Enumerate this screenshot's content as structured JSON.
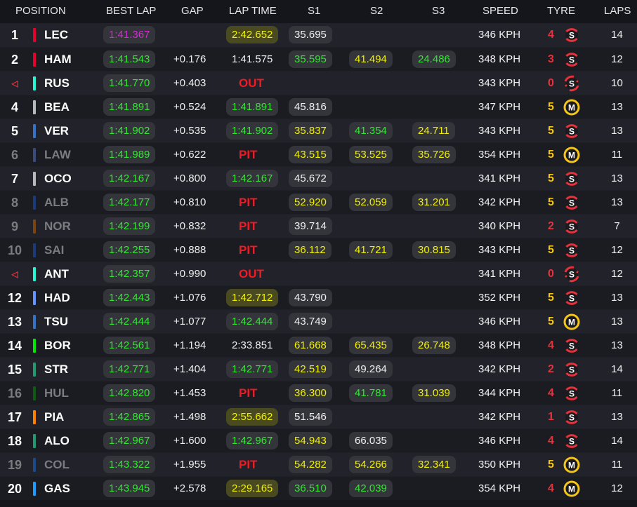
{
  "headers": {
    "position": "POSITION",
    "best_lap": "BEST LAP",
    "gap": "GAP",
    "lap_time": "LAP TIME",
    "s1": "S1",
    "s2": "S2",
    "s3": "S3",
    "speed": "SPEED",
    "tyre": "TYRE",
    "laps": "LAPS"
  },
  "colors": {
    "green": "#32e632",
    "yellow": "#f0f000",
    "purple": "#d42ad4",
    "red": "#ee1c25",
    "orange_age": "#ff8a1e",
    "red_age": "#e8313a",
    "soft": "#e8313a",
    "medium": "#f5c518"
  },
  "rows": [
    {
      "pos": "1",
      "code": "LEC",
      "team": "#e8002d",
      "dim": false,
      "best": "1:41.367",
      "best_color": "purple",
      "gap": "",
      "lap": "2:42.652",
      "lap_color": "yellow",
      "status": "",
      "s1": "35.695",
      "s1c": "white",
      "s2": "",
      "s2c": "",
      "s3": "",
      "s3c": "",
      "speed": "346 KPH",
      "age": "4",
      "tyre": "S",
      "tyre_icon": "soft-tyre-icon",
      "laps": "14"
    },
    {
      "pos": "2",
      "code": "HAM",
      "team": "#e8002d",
      "dim": false,
      "best": "1:41.543",
      "best_color": "green",
      "gap": "+0.176",
      "lap": "1:41.575",
      "lap_color": "plain",
      "status": "",
      "s1": "35.595",
      "s1c": "green",
      "s2": "41.494",
      "s2c": "yellow",
      "s3": "24.486",
      "s3c": "green",
      "speed": "348 KPH",
      "age": "3",
      "tyre": "S",
      "tyre_icon": "soft-tyre-icon",
      "laps": "12"
    },
    {
      "pos": "◁",
      "code": "RUS",
      "team": "#27f4d2",
      "dim": false,
      "best": "1:41.770",
      "best_color": "green",
      "gap": "+0.403",
      "lap": "",
      "lap_color": "",
      "status": "OUT",
      "s1": "",
      "s1c": "",
      "s2": "",
      "s2c": "",
      "s3": "",
      "s3c": "",
      "speed": "343 KPH",
      "age": "0",
      "tyre": "S",
      "tyre_icon": "soft-tyre-icon",
      "laps": "10"
    },
    {
      "pos": "4",
      "code": "BEA",
      "team": "#b6babd",
      "dim": false,
      "best": "1:41.891",
      "best_color": "green",
      "gap": "+0.524",
      "lap": "1:41.891",
      "lap_color": "green",
      "status": "",
      "s1": "45.816",
      "s1c": "white",
      "s2": "",
      "s2c": "",
      "s3": "",
      "s3c": "",
      "speed": "347 KPH",
      "age": "5",
      "tyre": "M",
      "tyre_icon": "medium-tyre-icon",
      "laps": "13"
    },
    {
      "pos": "5",
      "code": "VER",
      "team": "#3671c6",
      "dim": false,
      "best": "1:41.902",
      "best_color": "green",
      "gap": "+0.535",
      "lap": "1:41.902",
      "lap_color": "green",
      "status": "",
      "s1": "35.837",
      "s1c": "yellow",
      "s2": "41.354",
      "s2c": "green",
      "s3": "24.711",
      "s3c": "yellow",
      "speed": "343 KPH",
      "age": "5",
      "tyre": "S",
      "tyre_icon": "soft-tyre-icon",
      "laps": "13"
    },
    {
      "pos": "6",
      "code": "LAW",
      "team": "#3a4a7a",
      "dim": true,
      "best": "1:41.989",
      "best_color": "green",
      "gap": "+0.622",
      "lap": "",
      "lap_color": "",
      "status": "PIT",
      "s1": "43.515",
      "s1c": "yellow",
      "s2": "53.525",
      "s2c": "yellow",
      "s3": "35.726",
      "s3c": "yellow",
      "speed": "354 KPH",
      "age": "5",
      "tyre": "M",
      "tyre_icon": "medium-tyre-icon",
      "laps": "11"
    },
    {
      "pos": "7",
      "code": "OCO",
      "team": "#b6babd",
      "dim": false,
      "best": "1:42.167",
      "best_color": "green",
      "gap": "+0.800",
      "lap": "1:42.167",
      "lap_color": "green",
      "status": "",
      "s1": "45.672",
      "s1c": "white",
      "s2": "",
      "s2c": "",
      "s3": "",
      "s3c": "",
      "speed": "341 KPH",
      "age": "5",
      "tyre": "S",
      "tyre_icon": "soft-tyre-icon",
      "laps": "13"
    },
    {
      "pos": "8",
      "code": "ALB",
      "team": "#1a3a7a",
      "dim": true,
      "best": "1:42.177",
      "best_color": "green",
      "gap": "+0.810",
      "lap": "",
      "lap_color": "",
      "status": "PIT",
      "s1": "52.920",
      "s1c": "yellow",
      "s2": "52.059",
      "s2c": "yellow",
      "s3": "31.201",
      "s3c": "yellow",
      "speed": "342 KPH",
      "age": "5",
      "tyre": "S",
      "tyre_icon": "soft-tyre-icon",
      "laps": "13"
    },
    {
      "pos": "9",
      "code": "NOR",
      "team": "#7a4412",
      "dim": true,
      "best": "1:42.199",
      "best_color": "green",
      "gap": "+0.832",
      "lap": "",
      "lap_color": "",
      "status": "PIT",
      "s1": "39.714",
      "s1c": "white",
      "s2": "",
      "s2c": "",
      "s3": "",
      "s3c": "",
      "speed": "340 KPH",
      "age": "2",
      "tyre": "S",
      "tyre_icon": "soft-tyre-icon",
      "laps": "7"
    },
    {
      "pos": "10",
      "code": "SAI",
      "team": "#1a3a7a",
      "dim": true,
      "best": "1:42.255",
      "best_color": "green",
      "gap": "+0.888",
      "lap": "",
      "lap_color": "",
      "status": "PIT",
      "s1": "36.112",
      "s1c": "yellow",
      "s2": "41.721",
      "s2c": "yellow",
      "s3": "30.815",
      "s3c": "yellow",
      "speed": "343 KPH",
      "age": "5",
      "tyre": "S",
      "tyre_icon": "soft-tyre-icon",
      "laps": "12"
    },
    {
      "pos": "◁",
      "code": "ANT",
      "team": "#27f4d2",
      "dim": false,
      "best": "1:42.357",
      "best_color": "green",
      "gap": "+0.990",
      "lap": "",
      "lap_color": "",
      "status": "OUT",
      "s1": "",
      "s1c": "",
      "s2": "",
      "s2c": "",
      "s3": "",
      "s3c": "",
      "speed": "341 KPH",
      "age": "0",
      "tyre": "S",
      "tyre_icon": "soft-tyre-icon",
      "laps": "12"
    },
    {
      "pos": "12",
      "code": "HAD",
      "team": "#6692ff",
      "dim": false,
      "best": "1:42.443",
      "best_color": "green",
      "gap": "+1.076",
      "lap": "1:42.712",
      "lap_color": "yellow",
      "status": "",
      "s1": "43.790",
      "s1c": "white",
      "s2": "",
      "s2c": "",
      "s3": "",
      "s3c": "",
      "speed": "352 KPH",
      "age": "5",
      "tyre": "S",
      "tyre_icon": "soft-tyre-icon",
      "laps": "13"
    },
    {
      "pos": "13",
      "code": "TSU",
      "team": "#3671c6",
      "dim": false,
      "best": "1:42.444",
      "best_color": "green",
      "gap": "+1.077",
      "lap": "1:42.444",
      "lap_color": "green",
      "status": "",
      "s1": "43.749",
      "s1c": "white",
      "s2": "",
      "s2c": "",
      "s3": "",
      "s3c": "",
      "speed": "346 KPH",
      "age": "5",
      "tyre": "M",
      "tyre_icon": "medium-tyre-icon",
      "laps": "13"
    },
    {
      "pos": "14",
      "code": "BOR",
      "team": "#00e701",
      "dim": false,
      "best": "1:42.561",
      "best_color": "green",
      "gap": "+1.194",
      "lap": "2:33.851",
      "lap_color": "plain",
      "status": "",
      "s1": "61.668",
      "s1c": "yellow",
      "s2": "65.435",
      "s2c": "yellow",
      "s3": "26.748",
      "s3c": "yellow",
      "speed": "348 KPH",
      "age": "4",
      "tyre": "S",
      "tyre_icon": "soft-tyre-icon",
      "laps": "13"
    },
    {
      "pos": "15",
      "code": "STR",
      "team": "#229971",
      "dim": false,
      "best": "1:42.771",
      "best_color": "green",
      "gap": "+1.404",
      "lap": "1:42.771",
      "lap_color": "green",
      "status": "",
      "s1": "42.519",
      "s1c": "yellow",
      "s2": "49.264",
      "s2c": "white",
      "s3": "",
      "s3c": "",
      "speed": "342 KPH",
      "age": "2",
      "tyre": "S",
      "tyre_icon": "soft-tyre-icon",
      "laps": "14"
    },
    {
      "pos": "16",
      "code": "HUL",
      "team": "#0f5a12",
      "dim": true,
      "best": "1:42.820",
      "best_color": "green",
      "gap": "+1.453",
      "lap": "",
      "lap_color": "",
      "status": "PIT",
      "s1": "36.300",
      "s1c": "yellow",
      "s2": "41.781",
      "s2c": "green",
      "s3": "31.039",
      "s3c": "yellow",
      "speed": "344 KPH",
      "age": "4",
      "tyre": "S",
      "tyre_icon": "soft-tyre-icon",
      "laps": "11"
    },
    {
      "pos": "17",
      "code": "PIA",
      "team": "#ff8000",
      "dim": false,
      "best": "1:42.865",
      "best_color": "green",
      "gap": "+1.498",
      "lap": "2:55.662",
      "lap_color": "yellow",
      "status": "",
      "s1": "51.546",
      "s1c": "white",
      "s2": "",
      "s2c": "",
      "s3": "",
      "s3c": "",
      "speed": "342 KPH",
      "age": "1",
      "tyre": "S",
      "tyre_icon": "soft-tyre-icon",
      "laps": "13"
    },
    {
      "pos": "18",
      "code": "ALO",
      "team": "#229971",
      "dim": false,
      "best": "1:42.967",
      "best_color": "green",
      "gap": "+1.600",
      "lap": "1:42.967",
      "lap_color": "green",
      "status": "",
      "s1": "54.943",
      "s1c": "yellow",
      "s2": "66.035",
      "s2c": "white",
      "s3": "",
      "s3c": "",
      "speed": "346 KPH",
      "age": "4",
      "tyre": "S",
      "tyre_icon": "soft-tyre-icon",
      "laps": "14"
    },
    {
      "pos": "19",
      "code": "COL",
      "team": "#1a4a8a",
      "dim": true,
      "best": "1:43.322",
      "best_color": "green",
      "gap": "+1.955",
      "lap": "",
      "lap_color": "",
      "status": "PIT",
      "s1": "54.282",
      "s1c": "yellow",
      "s2": "54.266",
      "s2c": "yellow",
      "s3": "32.341",
      "s3c": "yellow",
      "speed": "350 KPH",
      "age": "5",
      "tyre": "M",
      "tyre_icon": "medium-tyre-icon",
      "laps": "11"
    },
    {
      "pos": "20",
      "code": "GAS",
      "team": "#1e9bff",
      "dim": false,
      "best": "1:43.945",
      "best_color": "green",
      "gap": "+2.578",
      "lap": "2:29.165",
      "lap_color": "yellow",
      "status": "",
      "s1": "36.510",
      "s1c": "green",
      "s2": "42.039",
      "s2c": "green",
      "s3": "",
      "s3c": "",
      "speed": "354 KPH",
      "age": "4",
      "tyre": "M",
      "tyre_icon": "medium-tyre-icon",
      "laps": "12"
    }
  ]
}
